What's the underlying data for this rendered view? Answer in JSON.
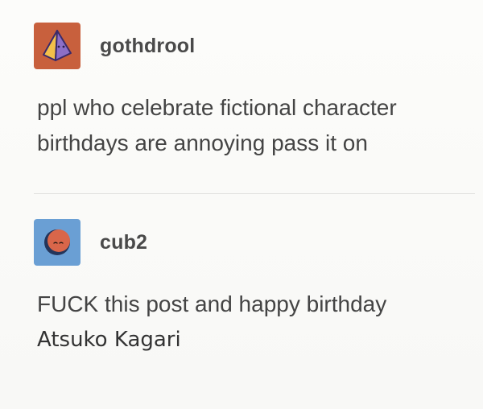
{
  "posts": [
    {
      "username": "gothdrool",
      "avatar_icon": "pyramid-icon",
      "avatar_bg": "#c8603d",
      "lines": [
        "ppl who celebrate fictional character",
        "birthdays are annoying pass it on"
      ]
    },
    {
      "username": "cub2",
      "avatar_icon": "moon-face-icon",
      "avatar_bg": "#6a9fd4",
      "lines": [
        "FUCK this post and happy birthday",
        "Atsuko Kagari"
      ]
    }
  ]
}
